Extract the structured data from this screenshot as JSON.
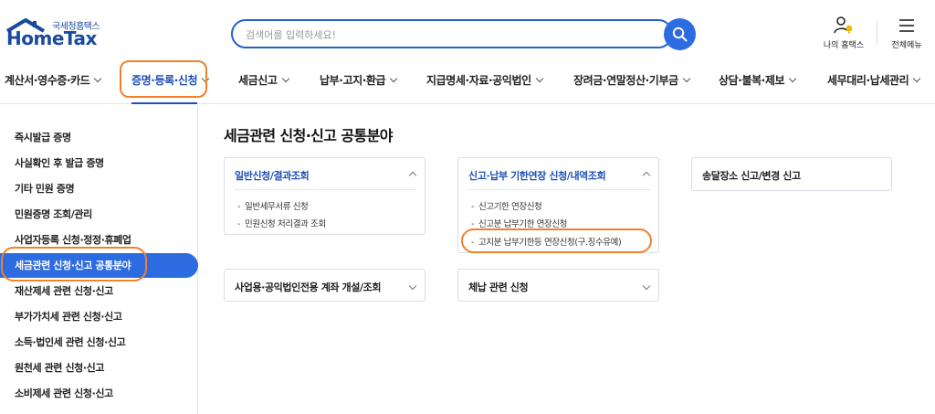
{
  "header": {
    "logo_sub": "국세청홈택스",
    "logo_main": "HomeTax",
    "search_placeholder": "검색어를 입력하세요!",
    "my_hometax": "나의 홈택스",
    "all_menu": "전체메뉴"
  },
  "nav": {
    "items": [
      "계산서·영수증·카드",
      "증명·등록·신청",
      "세금신고",
      "납부·고지·환급",
      "지급명세·자료·공익법인",
      "장려금·연말정산·기부금",
      "상담·불복·제보",
      "세무대리·납세관리"
    ]
  },
  "sidebar": {
    "items": [
      "즉시발급 증명",
      "사실확인 후 발급 증명",
      "기타 민원 증명",
      "민원증명 조회/관리",
      "사업자등록 신청·정정·휴폐업",
      "세금관련 신청·신고 공통분야",
      "재산제세 관련 신청·신고",
      "부가가치세 관련 신청·신고",
      "소득·법인세 관련 신청·신고",
      "원천세 관련 신청·신고",
      "소비제세 관련 신청·신고"
    ]
  },
  "content": {
    "title": "세금관련 신청·신고 공통분야",
    "cards": [
      {
        "title": "일반신청/결과조회",
        "links": [
          "일반세무서류 신청",
          "민원신청 처리결과 조회"
        ]
      },
      {
        "title": "신고·납부 기한연장 신청/내역조회",
        "links": [
          "신고기한 연장신청",
          "신고분 납부기한 연장신청",
          "고지분 납부기한등 연장신청(구.징수유예)"
        ]
      },
      {
        "title": "송달장소 신고/변경 신고",
        "links": []
      },
      {
        "title": "사업용·공익법인전용 계좌 개설/조회",
        "links": []
      },
      {
        "title": "체납 관련 신청",
        "links": []
      }
    ]
  },
  "colors": {
    "brand": "#1a4aa0",
    "accent": "#2d6be0",
    "highlight_ring": "#f0812b"
  }
}
